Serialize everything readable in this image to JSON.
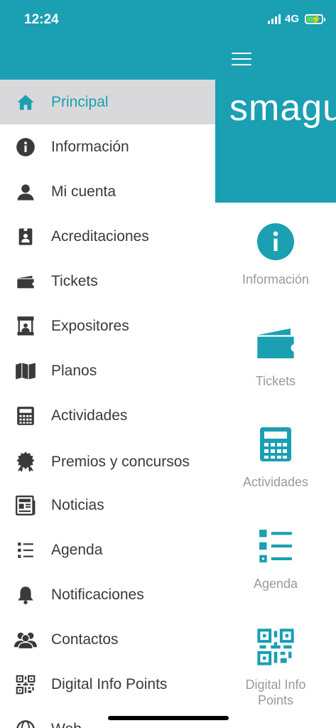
{
  "status_bar": {
    "time": "12:24",
    "network": "4G"
  },
  "brand": {
    "text": "smagu"
  },
  "drawer": {
    "items": [
      {
        "label": "Principal",
        "icon": "home-icon",
        "active": true
      },
      {
        "label": "Información",
        "icon": "info-icon"
      },
      {
        "label": "Mi cuenta",
        "icon": "user-icon"
      },
      {
        "label": "Acreditaciones",
        "icon": "badge-icon"
      },
      {
        "label": "Tickets",
        "icon": "ticket-icon"
      },
      {
        "label": "Expositores",
        "icon": "booth-icon"
      },
      {
        "label": "Planos",
        "icon": "map-icon"
      },
      {
        "label": "Actividades",
        "icon": "calculator-icon"
      },
      {
        "label": "Premios y concursos",
        "icon": "award-icon"
      },
      {
        "label": "Noticias",
        "icon": "newspaper-icon"
      },
      {
        "label": "Agenda",
        "icon": "list-icon"
      },
      {
        "label": "Notificaciones",
        "icon": "bell-icon"
      },
      {
        "label": "Contactos",
        "icon": "contacts-icon"
      },
      {
        "label": "Digital Info Points",
        "icon": "qr-icon"
      },
      {
        "label": "Web",
        "icon": "globe-icon"
      }
    ]
  },
  "tiles": [
    {
      "label": "Información",
      "icon": "info-icon"
    },
    {
      "label": "Tickets",
      "icon": "ticket-icon"
    },
    {
      "label": "Actividades",
      "icon": "calculator-icon"
    },
    {
      "label": "Agenda",
      "icon": "list-icon"
    },
    {
      "label": "Digital Info Points",
      "icon": "qr-icon"
    }
  ],
  "colors": {
    "accent": "#1a9fb3",
    "active_row": "#d9d9db",
    "text": "#3a3a3c",
    "tile_text": "#9a9a9e"
  }
}
